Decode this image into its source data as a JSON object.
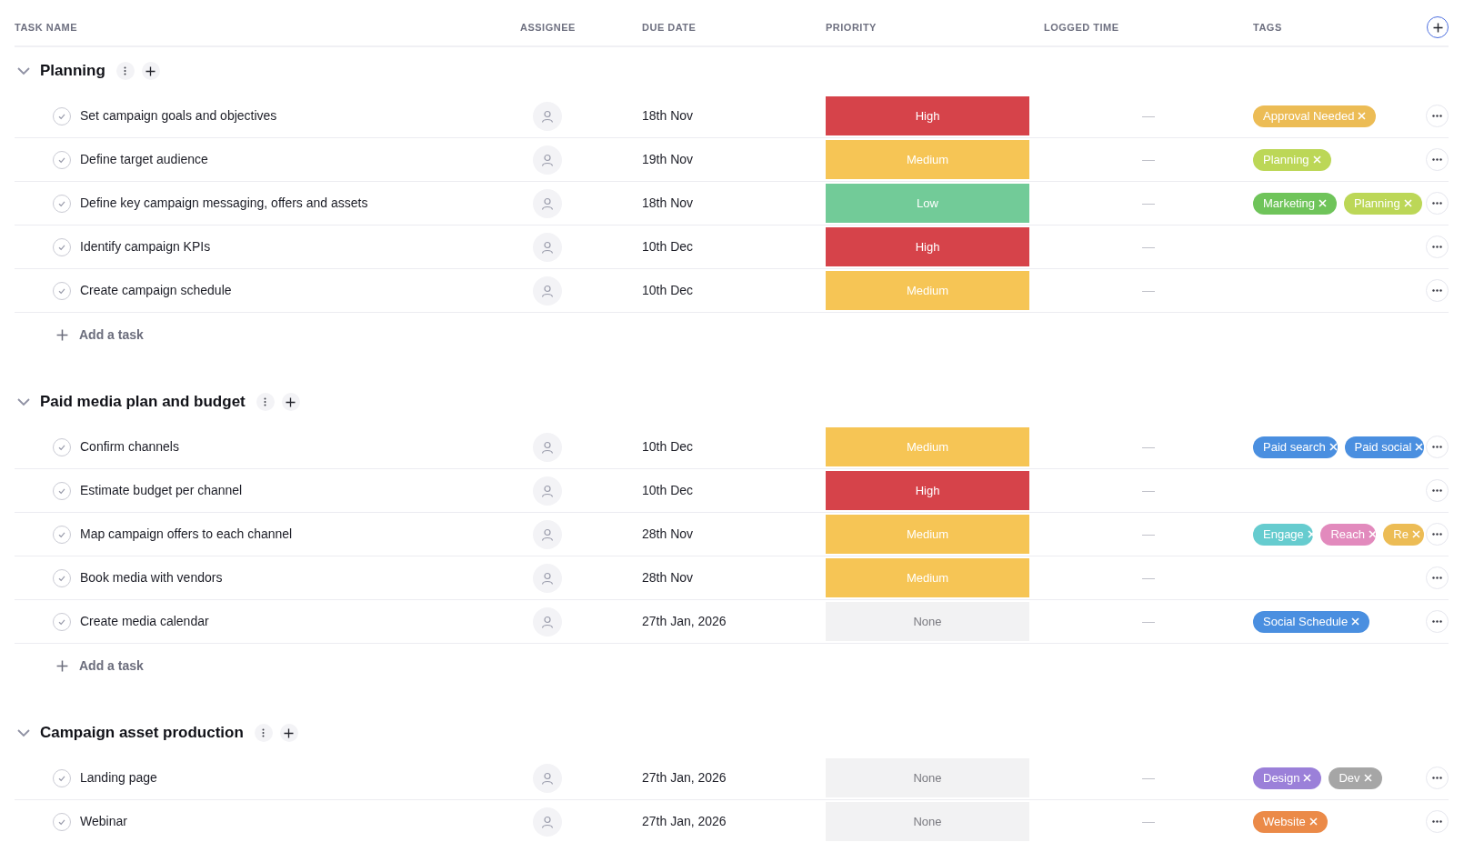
{
  "columns": [
    "TASK NAME",
    "ASSIGNEE",
    "DUE DATE",
    "PRIORITY",
    "LOGGED TIME",
    "TAGS"
  ],
  "groups": [
    {
      "title": "Planning",
      "expanded": true,
      "add_task": "Add a task",
      "tasks": [
        {
          "name": "Set campaign goals and objectives",
          "due": "18th Nov",
          "priority": {
            "label": "High",
            "color": "#d6434a"
          },
          "logged": "—",
          "tags": [
            {
              "label": "Approval Needed",
              "color": "#ecbc55"
            }
          ]
        },
        {
          "name": "Define target audience",
          "due": "19th Nov",
          "priority": {
            "label": "Medium",
            "color": "#f6c555"
          },
          "logged": "—",
          "tags": [
            {
              "label": "Planning",
              "color": "#bcd757"
            }
          ]
        },
        {
          "name": "Define key campaign messaging, offers and assets",
          "due": "18th Nov",
          "priority": {
            "label": "Low",
            "color": "#72cb98"
          },
          "logged": "—",
          "tags": [
            {
              "label": "Marketing",
              "color": "#6fc45a"
            },
            {
              "label": "Planning",
              "color": "#bcd757"
            }
          ]
        },
        {
          "name": "Identify campaign KPIs",
          "due": "10th Dec",
          "priority": {
            "label": "High",
            "color": "#d6434a"
          },
          "logged": "—"
        },
        {
          "name": "Create campaign schedule",
          "due": "10th Dec",
          "priority": {
            "label": "Medium",
            "color": "#f6c555"
          },
          "logged": "—"
        }
      ]
    },
    {
      "title": "Paid media plan and budget",
      "expanded": true,
      "add_task": "Add a task",
      "tasks": [
        {
          "name": "Confirm channels",
          "due": "10th Dec",
          "priority": {
            "label": "Medium",
            "color": "#f6c555"
          },
          "logged": "—",
          "tags": [
            {
              "label": "Paid search",
              "color": "#4a8fe0"
            },
            {
              "label": "Paid social",
              "color": "#4a8fe0"
            }
          ]
        },
        {
          "name": "Estimate budget per channel",
          "due": "10th Dec",
          "priority": {
            "label": "High",
            "color": "#d6434a"
          },
          "logged": "—"
        },
        {
          "name": "Map campaign offers to each channel",
          "due": "28th Nov",
          "priority": {
            "label": "Medium",
            "color": "#f6c555"
          },
          "logged": "—",
          "tags": [
            {
              "label": "Engage",
              "color": "#66cccf"
            },
            {
              "label": "Reach",
              "color": "#e28abd"
            },
            {
              "label": "Re",
              "color": "#ecbc55"
            }
          ]
        },
        {
          "name": "Book media with vendors",
          "due": "28th Nov",
          "priority": {
            "label": "Medium",
            "color": "#f6c555"
          },
          "logged": "—"
        },
        {
          "name": "Create media calendar",
          "due": "27th Jan, 2026",
          "priority": {
            "label": "None",
            "color": "#f2f2f3"
          },
          "logged": "—",
          "tags": [
            {
              "label": "Social Schedule",
              "color": "#4a8fe0"
            }
          ]
        }
      ]
    },
    {
      "title": "Campaign asset production",
      "expanded": true,
      "tasks": [
        {
          "name": "Landing page",
          "due": "27th Jan, 2026",
          "priority": {
            "label": "None",
            "color": "#f2f2f3"
          },
          "logged": "—",
          "tags": [
            {
              "label": "Design",
              "color": "#9b80d9"
            },
            {
              "label": "Dev",
              "color": "#a6a6a6"
            }
          ]
        },
        {
          "name": "Webinar",
          "due": "27th Jan, 2026",
          "priority": {
            "label": "None",
            "color": "#f2f2f3"
          },
          "logged": "—",
          "tags": [
            {
              "label": "Website",
              "color": "#eb8a48"
            }
          ]
        }
      ]
    }
  ]
}
